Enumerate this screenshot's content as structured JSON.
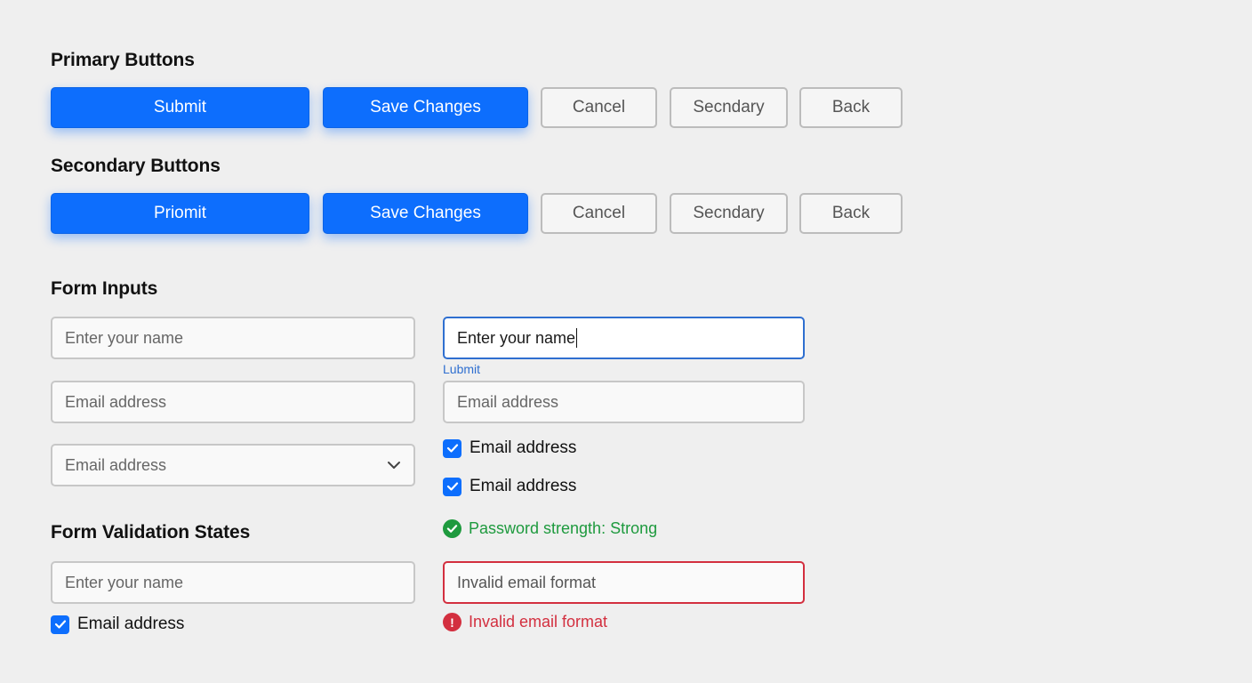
{
  "sections": {
    "primary_buttons": "Primary Buttons",
    "secondary_buttons": "Secondary Buttons",
    "form_inputs": "Form Inputs",
    "validation_states": "Form Validation States"
  },
  "primary_row": {
    "submit": "Submit",
    "save": "Save Changes",
    "cancel": "Cancel",
    "secondary": "Secndary",
    "back": "Back"
  },
  "secondary_row": {
    "submit": "Priomit",
    "save": "Save Changes",
    "cancel": "Cancel",
    "secondary": "Secndary",
    "back": "Back"
  },
  "inputs": {
    "name_placeholder": "Enter your name",
    "name_focused_value": "Enter your name",
    "focused_helper": "Lubmit",
    "email_placeholder": "Email address",
    "email_placeholder_2": "Email address",
    "select_value": "Email address",
    "checkbox_1": "Email address",
    "checkbox_2": "Email address"
  },
  "validation": {
    "name_placeholder": "Enter your name",
    "checkbox_label": "Email address",
    "success_message": "Password strength: Strong",
    "error_value": "Invalid email format",
    "error_message": "Invalid email format"
  },
  "colors": {
    "primary": "#0d6efd",
    "success": "#1e9a3e",
    "error": "#d32f3f",
    "focus": "#2f6fd0"
  },
  "icons": {
    "select_chevron": "chevron-down-icon",
    "checkbox_mark": "check-icon",
    "success": "check-circle-icon",
    "error": "exclamation-circle-icon"
  }
}
